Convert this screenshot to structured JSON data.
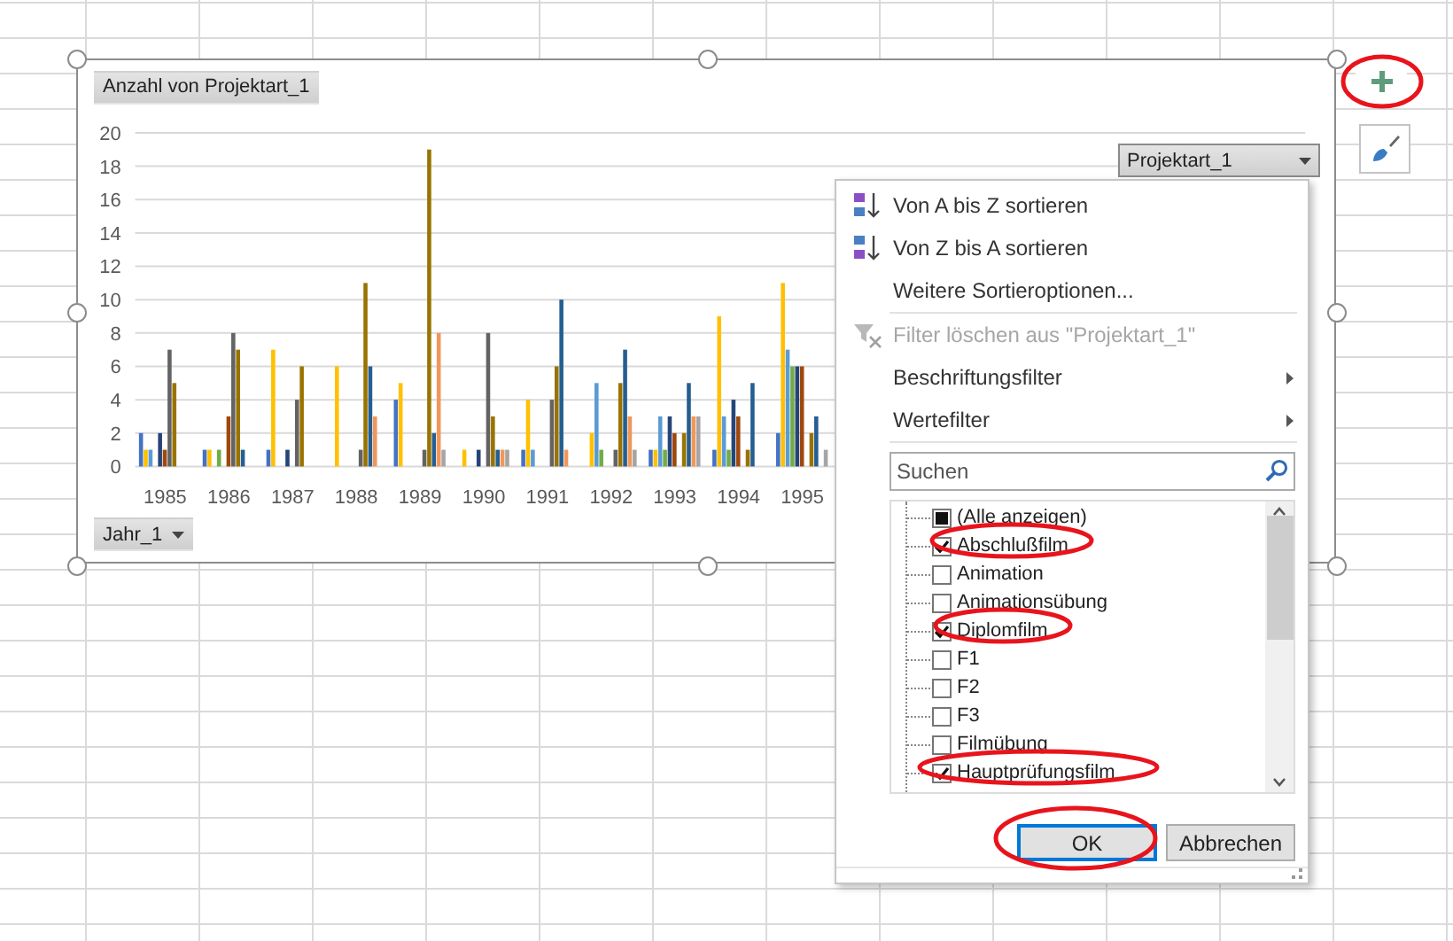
{
  "chart": {
    "value_field": "Anzahl von Projektart_1",
    "axis_field": "Jahr_1",
    "legend_field": "Projektart_1",
    "chart_data": {
      "type": "bar",
      "grid": true,
      "categories": [
        "1985",
        "1986",
        "1987",
        "1988",
        "1989",
        "1990",
        "1991",
        "1992",
        "1993",
        "1994",
        "1995"
      ],
      "ylim": [
        0,
        20
      ],
      "yticks": [
        0,
        2,
        4,
        6,
        8,
        10,
        12,
        14,
        16,
        18,
        20
      ],
      "series": [
        {
          "color": "#4472c4",
          "values": [
            2,
            1,
            1,
            null,
            4,
            null,
            1,
            null,
            1,
            1,
            2
          ]
        },
        {
          "color": "#ffc000",
          "values": [
            1,
            1,
            7,
            6,
            5,
            1,
            4,
            2,
            1,
            9,
            11
          ]
        },
        {
          "color": "#5b9bd5",
          "values": [
            1,
            null,
            null,
            null,
            null,
            null,
            1,
            5,
            3,
            3,
            7
          ]
        },
        {
          "color": "#70ad47",
          "values": [
            null,
            1,
            null,
            null,
            null,
            null,
            null,
            1,
            1,
            1,
            6
          ]
        },
        {
          "color": "#264478",
          "values": [
            2,
            null,
            1,
            null,
            null,
            1,
            null,
            null,
            3,
            4,
            6
          ]
        },
        {
          "color": "#9e480e",
          "values": [
            1,
            3,
            null,
            null,
            null,
            null,
            null,
            null,
            2,
            3,
            6
          ]
        },
        {
          "color": "#636363",
          "values": [
            7,
            8,
            4,
            1,
            1,
            8,
            4,
            1,
            null,
            null,
            null
          ]
        },
        {
          "color": "#997300",
          "values": [
            5,
            7,
            6,
            11,
            19,
            3,
            6,
            5,
            2,
            1,
            2
          ]
        },
        {
          "color": "#255e91",
          "values": [
            null,
            1,
            null,
            6,
            2,
            1,
            10,
            7,
            5,
            5,
            3
          ]
        },
        {
          "color": "#f1975a",
          "values": [
            null,
            null,
            null,
            3,
            8,
            1,
            1,
            3,
            3,
            null,
            null
          ]
        },
        {
          "color": "#a5a5a5",
          "values": [
            null,
            null,
            null,
            null,
            1,
            1,
            null,
            1,
            3,
            null,
            1
          ]
        }
      ]
    }
  },
  "filter_menu": {
    "items": [
      {
        "kind": "sort-asc",
        "label": "Von A bis Z sortieren",
        "disabled": false
      },
      {
        "kind": "sort-desc",
        "label": "Von Z bis A sortieren",
        "disabled": false
      },
      {
        "kind": "plain",
        "label": "Weitere Sortieroptionen...",
        "disabled": false
      },
      {
        "kind": "clear-filter",
        "label": "Filter löschen aus \"Projektart_1\"",
        "disabled": true
      },
      {
        "kind": "submenu",
        "label": "Beschriftungsfilter",
        "disabled": false
      },
      {
        "kind": "submenu",
        "label": "Wertefilter",
        "disabled": false
      }
    ],
    "search": {
      "placeholder": "Suchen"
    },
    "options": [
      {
        "label": "(Alle anzeigen)",
        "checked": false,
        "partial": true
      },
      {
        "label": "Abschlußfilm",
        "checked": true,
        "partial": false
      },
      {
        "label": "Animation",
        "checked": false,
        "partial": false
      },
      {
        "label": "Animationsübung",
        "checked": false,
        "partial": false
      },
      {
        "label": "Diplomfilm",
        "checked": true,
        "partial": false
      },
      {
        "label": "F1",
        "checked": false,
        "partial": false
      },
      {
        "label": "F2",
        "checked": false,
        "partial": false
      },
      {
        "label": "F3",
        "checked": false,
        "partial": false
      },
      {
        "label": "Filmübung",
        "checked": false,
        "partial": false
      },
      {
        "label": "Hauptprüfungsfilm",
        "checked": true,
        "partial": false
      }
    ],
    "buttons": [
      {
        "label": "OK",
        "selected": true
      },
      {
        "label": "Abbrechen",
        "selected": false
      }
    ]
  }
}
